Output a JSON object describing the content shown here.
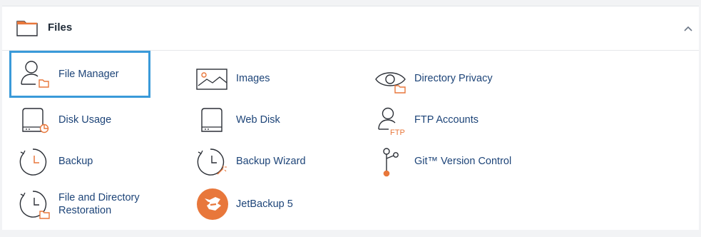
{
  "section": {
    "title": "Files",
    "icon": "folder-icon",
    "collapse_icon": "chevron-up-icon"
  },
  "colors": {
    "accent_orange": "#e8773b",
    "link_blue": "#1d4478",
    "selection_blue": "#3a9ad9"
  },
  "items": [
    {
      "label": "File Manager",
      "icon": "file-manager-icon",
      "selected": true
    },
    {
      "label": "Images",
      "icon": "images-icon"
    },
    {
      "label": "Directory Privacy",
      "icon": "directory-privacy-icon"
    },
    {
      "label": "Disk Usage",
      "icon": "disk-usage-icon"
    },
    {
      "label": "Web Disk",
      "icon": "web-disk-icon"
    },
    {
      "label": "FTP Accounts",
      "icon": "ftp-accounts-icon"
    },
    {
      "label": "Backup",
      "icon": "backup-icon"
    },
    {
      "label": "Backup Wizard",
      "icon": "backup-wizard-icon"
    },
    {
      "label": "Git™ Version Control",
      "icon": "git-version-control-icon"
    },
    {
      "label": "File and Directory Restoration",
      "icon": "file-directory-restoration-icon"
    },
    {
      "label": "JetBackup 5",
      "icon": "jetbackup-icon"
    }
  ],
  "ftp_icon_text": "FTP"
}
